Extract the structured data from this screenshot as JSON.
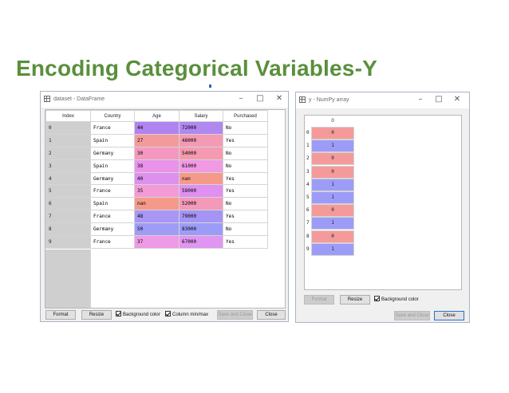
{
  "slide": {
    "title": "Encoding Categorical Variables-Y"
  },
  "dataframe_window": {
    "title": "dataset - DataFrame",
    "columns": [
      "Index",
      "Country",
      "Age",
      "Salary",
      "Purchased"
    ],
    "rows": [
      {
        "index": "0",
        "country": "France",
        "age": "44",
        "salary": "72000",
        "purchased": "No"
      },
      {
        "index": "1",
        "country": "Spain",
        "age": "27",
        "salary": "48000",
        "purchased": "Yes"
      },
      {
        "index": "2",
        "country": "Germany",
        "age": "30",
        "salary": "54000",
        "purchased": "No"
      },
      {
        "index": "3",
        "country": "Spain",
        "age": "38",
        "salary": "61000",
        "purchased": "No"
      },
      {
        "index": "4",
        "country": "Germany",
        "age": "40",
        "salary": "nan",
        "purchased": "Yes"
      },
      {
        "index": "5",
        "country": "France",
        "age": "35",
        "salary": "58000",
        "purchased": "Yes"
      },
      {
        "index": "6",
        "country": "Spain",
        "age": "nan",
        "salary": "52000",
        "purchased": "No"
      },
      {
        "index": "7",
        "country": "France",
        "age": "48",
        "salary": "79000",
        "purchased": "Yes"
      },
      {
        "index": "8",
        "country": "Germany",
        "age": "50",
        "salary": "83000",
        "purchased": "No"
      },
      {
        "index": "9",
        "country": "France",
        "age": "37",
        "salary": "67000",
        "purchased": "Yes"
      }
    ],
    "age_colors": [
      "#b083f0",
      "#f59a9a",
      "#f498c0",
      "#e892ea",
      "#dd90f0",
      "#f49ad6",
      "#f59a8a",
      "#a996f5",
      "#9f9cf7",
      "#ef9ae6"
    ],
    "salary_colors": [
      "#b088f0",
      "#f49ab4",
      "#f59ab0",
      "#f09ae4",
      "#f59a8a",
      "#e090f0",
      "#f29ab8",
      "#a494f5",
      "#9c9cf8",
      "#e096f0"
    ],
    "buttons": {
      "format": "Format",
      "resize": "Resize",
      "background_color": "Background color",
      "column_minmax": "Column min/max",
      "save_close": "Save and Close",
      "close": "Close"
    }
  },
  "numpy_window": {
    "title": "y - NumPy array",
    "column_header": "0",
    "row_labels": [
      "0",
      "1",
      "2",
      "3",
      "4",
      "5",
      "6",
      "7",
      "8",
      "9"
    ],
    "values": [
      "0",
      "1",
      "0",
      "0",
      "1",
      "1",
      "0",
      "1",
      "0",
      "1"
    ],
    "colors": {
      "zero": "#f59a9a",
      "one": "#9c9cf8"
    },
    "buttons": {
      "format": "Format",
      "resize": "Resize",
      "background_color": "Background color",
      "save_close": "Save and Close",
      "close": "Close"
    }
  }
}
